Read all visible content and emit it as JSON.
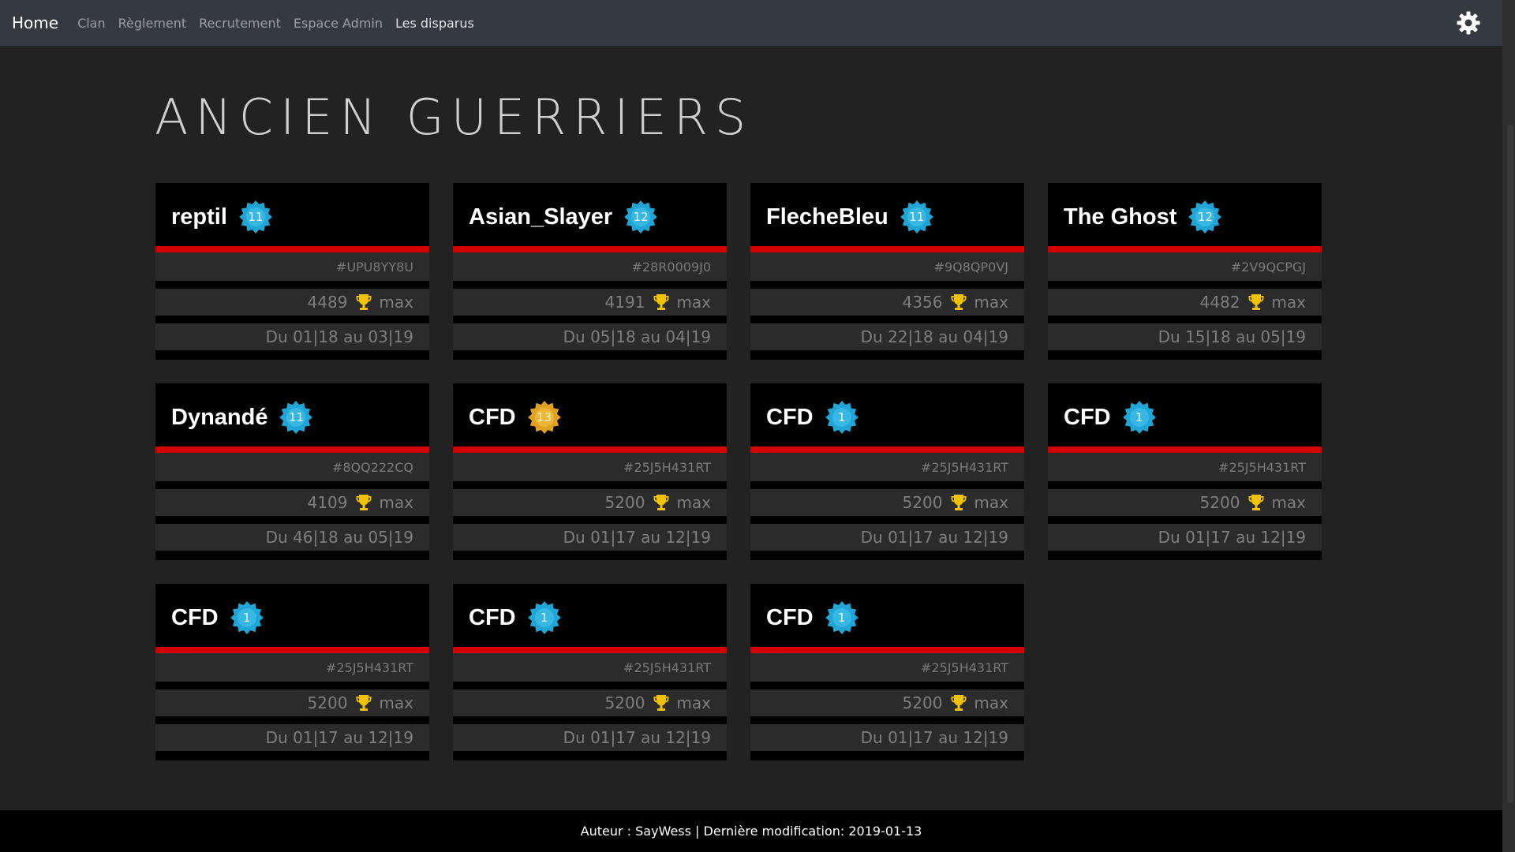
{
  "nav": {
    "brand": "Home",
    "links": [
      "Clan",
      "Règlement",
      "Recrutement",
      "Espace Admin",
      "Les disparus"
    ]
  },
  "page": {
    "title": "ANCIEN GUERRIERS"
  },
  "cards": [
    {
      "name": "reptil",
      "level": "11",
      "badge": "blue",
      "tag": "#UPU8YY8U",
      "trophies": "4489",
      "trophy_suffix": "max",
      "period": "Du 01|18 au 03|19"
    },
    {
      "name": "Asian_Slayer",
      "level": "12",
      "badge": "blue",
      "tag": "#28R0009J0",
      "trophies": "4191",
      "trophy_suffix": "max",
      "period": "Du 05|18 au 04|19"
    },
    {
      "name": "FlecheBleu",
      "level": "11",
      "badge": "blue",
      "tag": "#9Q8QP0VJ",
      "trophies": "4356",
      "trophy_suffix": "max",
      "period": "Du 22|18 au 04|19"
    },
    {
      "name": "The Ghost",
      "level": "12",
      "badge": "blue",
      "tag": "#2V9QCPGJ",
      "trophies": "4482",
      "trophy_suffix": "max",
      "period": "Du 15|18 au 05|19"
    },
    {
      "name": "Dynandé",
      "level": "11",
      "badge": "blue",
      "tag": "#8QQ222CQ",
      "trophies": "4109",
      "trophy_suffix": "max",
      "period": "Du 46|18 au 05|19"
    },
    {
      "name": "CFD",
      "level": "13",
      "badge": "gold",
      "tag": "#25J5H431RT",
      "trophies": "5200",
      "trophy_suffix": "max",
      "period": "Du 01|17 au 12|19"
    },
    {
      "name": "CFD",
      "level": "1",
      "badge": "blue",
      "tag": "#25J5H431RT",
      "trophies": "5200",
      "trophy_suffix": "max",
      "period": "Du 01|17 au 12|19"
    },
    {
      "name": "CFD",
      "level": "1",
      "badge": "blue",
      "tag": "#25J5H431RT",
      "trophies": "5200",
      "trophy_suffix": "max",
      "period": "Du 01|17 au 12|19"
    },
    {
      "name": "CFD",
      "level": "1",
      "badge": "blue",
      "tag": "#25J5H431RT",
      "trophies": "5200",
      "trophy_suffix": "max",
      "period": "Du 01|17 au 12|19"
    },
    {
      "name": "CFD",
      "level": "1",
      "badge": "blue",
      "tag": "#25J5H431RT",
      "trophies": "5200",
      "trophy_suffix": "max",
      "period": "Du 01|17 au 12|19"
    },
    {
      "name": "CFD",
      "level": "1",
      "badge": "blue",
      "tag": "#25J5H431RT",
      "trophies": "5200",
      "trophy_suffix": "max",
      "period": "Du 01|17 au 12|19"
    }
  ],
  "footer": {
    "text": "Auteur : SayWess | Dernière modification: 2019-01-13"
  },
  "colors": {
    "accent_red": "#d40000",
    "badge_blue": "#1fa6d6",
    "badge_gold": "#e0a020",
    "trophy_gold": "#f2c200"
  },
  "icons": {
    "settings": "gear-icon",
    "trophy": "trophy-icon",
    "badge": "level-badge-icon"
  }
}
